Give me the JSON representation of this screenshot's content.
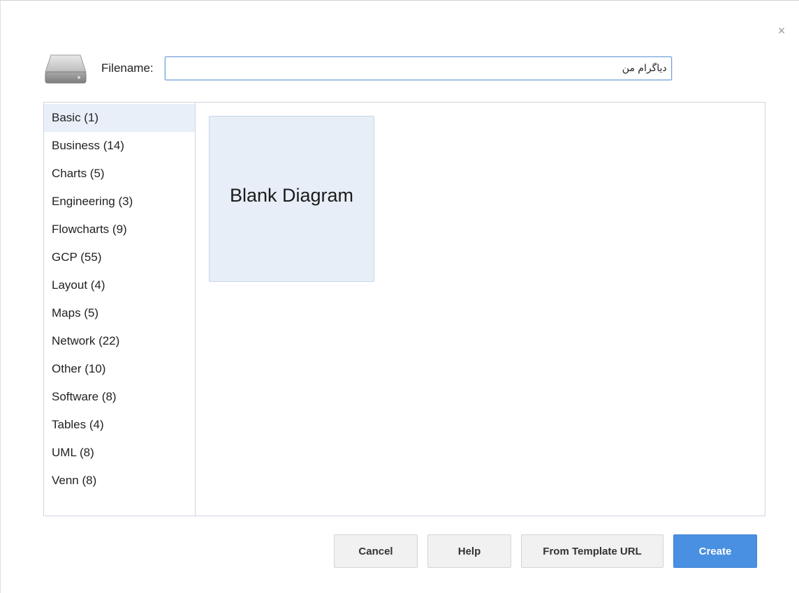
{
  "header": {
    "filename_label": "Filename:",
    "filename_value": "دیاگرام من"
  },
  "categories": [
    {
      "label": "Basic (1)",
      "selected": true
    },
    {
      "label": "Business (14)"
    },
    {
      "label": "Charts (5)"
    },
    {
      "label": "Engineering (3)"
    },
    {
      "label": "Flowcharts (9)"
    },
    {
      "label": "GCP (55)"
    },
    {
      "label": "Layout (4)"
    },
    {
      "label": "Maps (5)"
    },
    {
      "label": "Network (22)"
    },
    {
      "label": "Other (10)"
    },
    {
      "label": "Software (8)"
    },
    {
      "label": "Tables (4)"
    },
    {
      "label": "UML (8)"
    },
    {
      "label": "Venn (8)"
    }
  ],
  "templates": [
    {
      "label": "Blank Diagram"
    }
  ],
  "buttons": {
    "cancel": "Cancel",
    "help": "Help",
    "from_template_url": "From Template URL",
    "create": "Create"
  },
  "icons": {
    "close": "close-icon",
    "drive": "drive-icon"
  },
  "colors": {
    "accent": "#4a90e2",
    "selected_bg": "#e9eff8",
    "tile_bg": "#e7eef8"
  }
}
